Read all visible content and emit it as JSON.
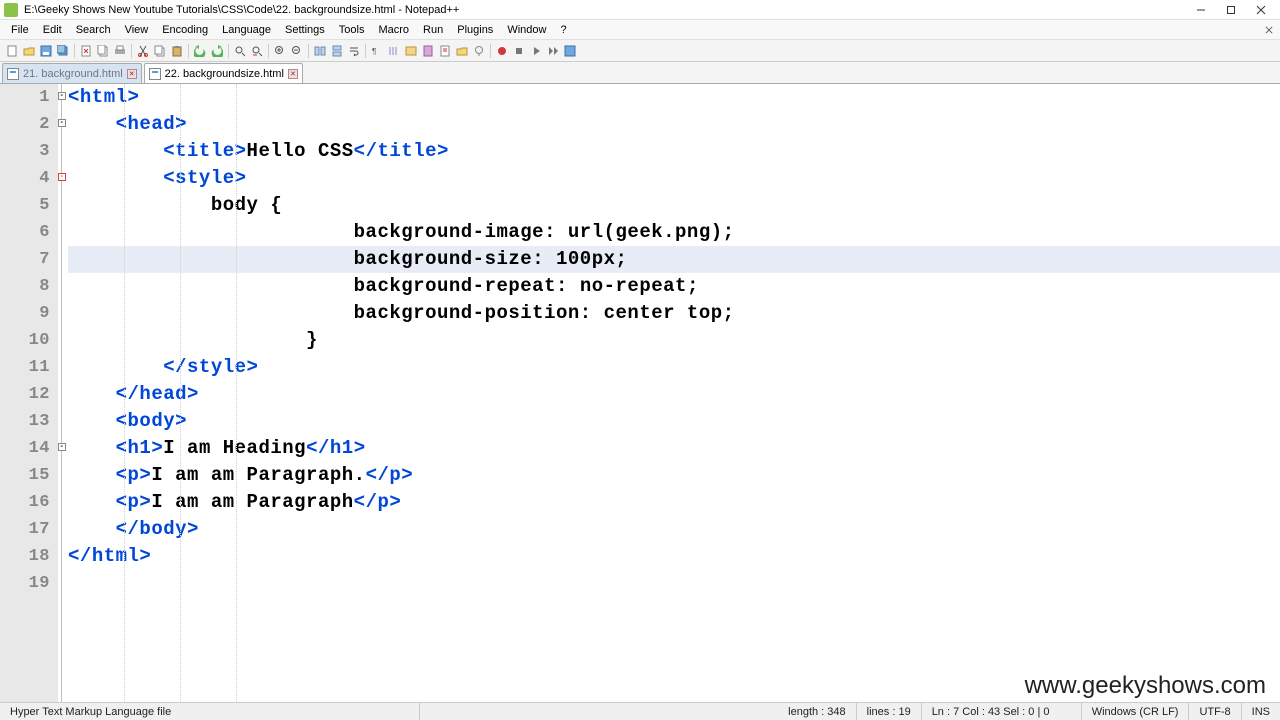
{
  "window": {
    "title": "E:\\Geeky Shows New Youtube Tutorials\\CSS\\Code\\22. backgroundsize.html - Notepad++"
  },
  "menu": {
    "items": [
      "File",
      "Edit",
      "Search",
      "View",
      "Encoding",
      "Language",
      "Settings",
      "Tools",
      "Macro",
      "Run",
      "Plugins",
      "Window",
      "?"
    ]
  },
  "tabs": [
    {
      "label": "21. background.html",
      "active": false
    },
    {
      "label": "22. backgroundsize.html",
      "active": true
    }
  ],
  "code": {
    "lines": [
      "<html>",
      "    <head>",
      "        <title>Hello CSS</title>",
      "        <style>",
      "            body {",
      "                        background-image: url(geek.png);",
      "                        background-size: 100px;",
      "                        background-repeat: no-repeat;",
      "                        background-position: center top;",
      "                    }",
      "        </style>",
      "    </head>",
      "    <body>",
      "    <h1>I am Heading</h1>",
      "    <p>I am am Paragraph.</p>",
      "    <p>I am am Paragraph</p>",
      "    </body>",
      "</html>",
      ""
    ],
    "highlight_line": 7,
    "title_text": "Hello CSS",
    "h1_text": "I am Heading",
    "p1_text": "I am am Paragraph.",
    "p2_text": "I am am Paragraph",
    "css_body": [
      "background-image: url(geek.png);",
      "background-size: 100px;",
      "background-repeat: no-repeat;",
      "background-position: center top;"
    ]
  },
  "status": {
    "file_type": "Hyper Text Markup Language file",
    "length": "length : 348",
    "lines": "lines : 19",
    "pos": "Ln : 7   Col : 43   Sel : 0 | 0",
    "eol": "Windows (CR LF)",
    "enc": "UTF-8",
    "mode": "INS"
  },
  "watermark": "www.geekyshows.com"
}
